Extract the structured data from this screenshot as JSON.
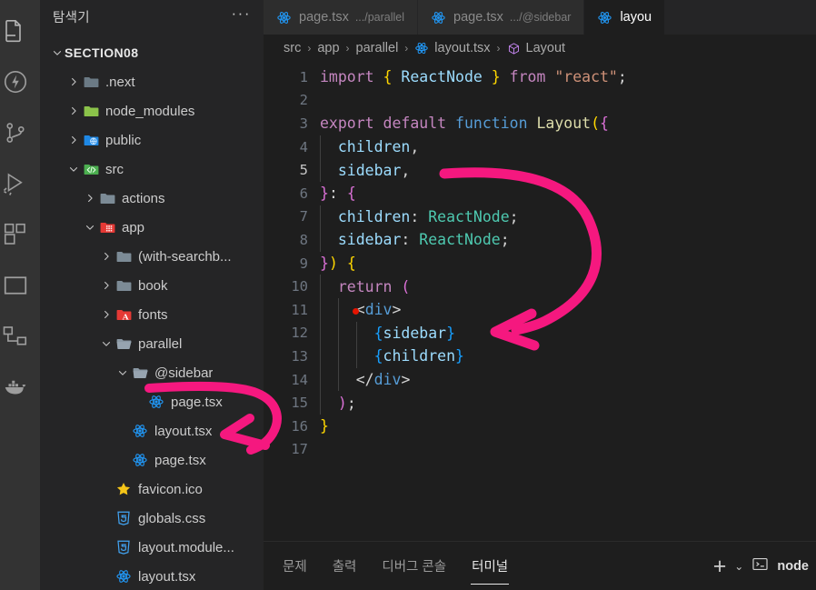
{
  "activity_bar": {
    "items": [
      {
        "name": "explorer-icon",
        "title": "탐색기"
      },
      {
        "name": "lightning-icon",
        "title": "실행"
      },
      {
        "name": "source-control-icon",
        "title": "소스 제어"
      },
      {
        "name": "run-debug-icon",
        "title": "실행 및 디버그"
      },
      {
        "name": "extensions-icon",
        "title": "확장"
      },
      {
        "name": "square-icon",
        "title": "패널"
      },
      {
        "name": "remote-explorer-icon",
        "title": "원격 탐색기"
      },
      {
        "name": "docker-icon",
        "title": "Docker"
      }
    ]
  },
  "sidebar": {
    "header": {
      "title": "탐색기",
      "more_label": "···"
    },
    "root": {
      "label": "SECTION08",
      "expanded": true
    },
    "tree": [
      {
        "label": ".next",
        "type": "folder",
        "icon": "folder-next",
        "depth": 1,
        "arrow": "collapsed"
      },
      {
        "label": "node_modules",
        "type": "folder",
        "icon": "folder-node",
        "depth": 1,
        "arrow": "collapsed"
      },
      {
        "label": "public",
        "type": "folder",
        "icon": "folder-public",
        "depth": 1,
        "arrow": "collapsed"
      },
      {
        "label": "src",
        "type": "folder",
        "icon": "folder-src",
        "depth": 1,
        "arrow": "expanded"
      },
      {
        "label": "actions",
        "type": "folder",
        "icon": "folder-plain",
        "depth": 2,
        "arrow": "collapsed"
      },
      {
        "label": "app",
        "type": "folder",
        "icon": "folder-app",
        "depth": 2,
        "arrow": "expanded"
      },
      {
        "label": "(with-searchb...",
        "type": "folder",
        "icon": "folder-plain",
        "depth": 3,
        "arrow": "collapsed"
      },
      {
        "label": "book",
        "type": "folder",
        "icon": "folder-plain",
        "depth": 3,
        "arrow": "collapsed"
      },
      {
        "label": "fonts",
        "type": "folder",
        "icon": "folder-fonts",
        "depth": 3,
        "arrow": "collapsed"
      },
      {
        "label": "parallel",
        "type": "folder",
        "icon": "folder-open",
        "depth": 3,
        "arrow": "expanded"
      },
      {
        "label": "@sidebar",
        "type": "folder",
        "icon": "folder-open",
        "depth": 4,
        "arrow": "expanded"
      },
      {
        "label": "page.tsx",
        "type": "file",
        "icon": "react-icon",
        "depth": 5,
        "arrow": "none"
      },
      {
        "label": "layout.tsx",
        "type": "file",
        "icon": "react-icon",
        "depth": 4,
        "arrow": "none"
      },
      {
        "label": "page.tsx",
        "type": "file",
        "icon": "react-icon",
        "depth": 4,
        "arrow": "none"
      },
      {
        "label": "favicon.ico",
        "type": "file",
        "icon": "favicon-icon",
        "depth": 3,
        "arrow": "none"
      },
      {
        "label": "globals.css",
        "type": "file",
        "icon": "css-icon",
        "depth": 3,
        "arrow": "none"
      },
      {
        "label": "layout.module...",
        "type": "file",
        "icon": "css-icon",
        "depth": 3,
        "arrow": "none"
      },
      {
        "label": "layout.tsx",
        "type": "file",
        "icon": "react-icon",
        "depth": 3,
        "arrow": "none"
      }
    ]
  },
  "editor": {
    "tabs": [
      {
        "name": "page.tsx",
        "path": ".../parallel",
        "active": false,
        "icon": "react-icon"
      },
      {
        "name": "page.tsx",
        "path": ".../@sidebar",
        "active": false,
        "icon": "react-icon"
      },
      {
        "name": "layou",
        "path": "",
        "active": true,
        "icon": "react-icon"
      }
    ],
    "breadcrumb": [
      {
        "label": "src",
        "icon": ""
      },
      {
        "label": "app",
        "icon": ""
      },
      {
        "label": "parallel",
        "icon": ""
      },
      {
        "label": "layout.tsx",
        "icon": "react-icon"
      },
      {
        "label": "Layout",
        "icon": "symbol-method-icon"
      }
    ],
    "breadcrumb_separator": "›",
    "lines": [
      {
        "n": "1",
        "tokens": [
          {
            "t": "import",
            "c": "t-kw"
          },
          {
            "t": " ",
            "c": "t-pl"
          },
          {
            "t": "{",
            "c": "t-br1"
          },
          {
            "t": " ",
            "c": "t-pl"
          },
          {
            "t": "ReactNode",
            "c": "t-var"
          },
          {
            "t": " ",
            "c": "t-pl"
          },
          {
            "t": "}",
            "c": "t-br1"
          },
          {
            "t": " ",
            "c": "t-pl"
          },
          {
            "t": "from",
            "c": "t-kw"
          },
          {
            "t": " ",
            "c": "t-pl"
          },
          {
            "t": "\"react\"",
            "c": "t-str"
          },
          {
            "t": ";",
            "c": "t-pl"
          }
        ]
      },
      {
        "n": "2",
        "tokens": []
      },
      {
        "n": "3",
        "tokens": [
          {
            "t": "export",
            "c": "t-kw"
          },
          {
            "t": " ",
            "c": "t-pl"
          },
          {
            "t": "default",
            "c": "t-kw"
          },
          {
            "t": " ",
            "c": "t-pl"
          },
          {
            "t": "function",
            "c": "t-ctl"
          },
          {
            "t": " ",
            "c": "t-pl"
          },
          {
            "t": "Layout",
            "c": "t-fn"
          },
          {
            "t": "(",
            "c": "t-br1"
          },
          {
            "t": "{",
            "c": "t-br2"
          }
        ]
      },
      {
        "n": "4",
        "tokens": [
          {
            "t": "  ",
            "c": "t-pl"
          },
          {
            "t": "children",
            "c": "t-var"
          },
          {
            "t": ",",
            "c": "t-pl"
          }
        ]
      },
      {
        "n": "5",
        "tokens": [
          {
            "t": "  ",
            "c": "t-pl"
          },
          {
            "t": "sidebar",
            "c": "t-var"
          },
          {
            "t": ",",
            "c": "t-pl"
          }
        ]
      },
      {
        "n": "6",
        "tokens": [
          {
            "t": "}",
            "c": "t-br2"
          },
          {
            "t": ": ",
            "c": "t-pl"
          },
          {
            "t": "{",
            "c": "t-br2"
          }
        ]
      },
      {
        "n": "7",
        "tokens": [
          {
            "t": "  ",
            "c": "t-pl"
          },
          {
            "t": "children",
            "c": "t-var"
          },
          {
            "t": ": ",
            "c": "t-pl"
          },
          {
            "t": "ReactNode",
            "c": "t-type"
          },
          {
            "t": ";",
            "c": "t-pl"
          }
        ]
      },
      {
        "n": "8",
        "tokens": [
          {
            "t": "  ",
            "c": "t-pl"
          },
          {
            "t": "sidebar",
            "c": "t-var"
          },
          {
            "t": ": ",
            "c": "t-pl"
          },
          {
            "t": "ReactNode",
            "c": "t-type"
          },
          {
            "t": ";",
            "c": "t-pl"
          }
        ]
      },
      {
        "n": "9",
        "tokens": [
          {
            "t": "}",
            "c": "t-br2"
          },
          {
            "t": ")",
            "c": "t-br1"
          },
          {
            "t": " ",
            "c": "t-pl"
          },
          {
            "t": "{",
            "c": "t-br1"
          }
        ]
      },
      {
        "n": "10",
        "tokens": [
          {
            "t": "  ",
            "c": "t-pl"
          },
          {
            "t": "return",
            "c": "t-kw"
          },
          {
            "t": " ",
            "c": "t-pl"
          },
          {
            "t": "(",
            "c": "t-br2"
          }
        ]
      },
      {
        "n": "11",
        "tokens": [
          {
            "t": "    ",
            "c": "t-pl"
          },
          {
            "t": "<",
            "c": "t-pl"
          },
          {
            "t": "div",
            "c": "t-tag"
          },
          {
            "t": ">",
            "c": "t-pl"
          }
        ],
        "breakpoint": true
      },
      {
        "n": "12",
        "tokens": [
          {
            "t": "      ",
            "c": "t-pl"
          },
          {
            "t": "{",
            "c": "t-br3"
          },
          {
            "t": "sidebar",
            "c": "t-var"
          },
          {
            "t": "}",
            "c": "t-br3"
          }
        ]
      },
      {
        "n": "13",
        "tokens": [
          {
            "t": "      ",
            "c": "t-pl"
          },
          {
            "t": "{",
            "c": "t-br3"
          },
          {
            "t": "children",
            "c": "t-var"
          },
          {
            "t": "}",
            "c": "t-br3"
          }
        ]
      },
      {
        "n": "14",
        "tokens": [
          {
            "t": "    ",
            "c": "t-pl"
          },
          {
            "t": "</",
            "c": "t-pl"
          },
          {
            "t": "div",
            "c": "t-tag"
          },
          {
            "t": ">",
            "c": "t-pl"
          }
        ]
      },
      {
        "n": "15",
        "tokens": [
          {
            "t": "  ",
            "c": "t-pl"
          },
          {
            "t": ")",
            "c": "t-br2"
          },
          {
            "t": ";",
            "c": "t-pl"
          }
        ]
      },
      {
        "n": "16",
        "tokens": [
          {
            "t": "}",
            "c": "t-br1"
          }
        ]
      },
      {
        "n": "17",
        "tokens": []
      }
    ]
  },
  "panel": {
    "tabs": [
      {
        "label": "문제",
        "active": false
      },
      {
        "label": "출력",
        "active": false
      },
      {
        "label": "디버그 콘솔",
        "active": false
      },
      {
        "label": "터미널",
        "active": true
      }
    ],
    "add_label": "+",
    "chevron_label": "⌄",
    "terminal_name": "node"
  },
  "annotations": {
    "color": "#f5187f",
    "marks": [
      {
        "name": "arrow-sidebar-to-jsx",
        "desc": "curved arrow from line 5 sidebar to line 12 {sidebar}"
      },
      {
        "name": "arrow-atsidebar-to-layout",
        "desc": "underline under @sidebar curving to layout.tsx"
      }
    ]
  },
  "colors": {
    "accent_pink": "#f5187f",
    "editor_bg": "#1e1e1e",
    "sidebar_bg": "#252526",
    "activity_bg": "#333333",
    "tab_inactive_bg": "#2d2d2d"
  }
}
